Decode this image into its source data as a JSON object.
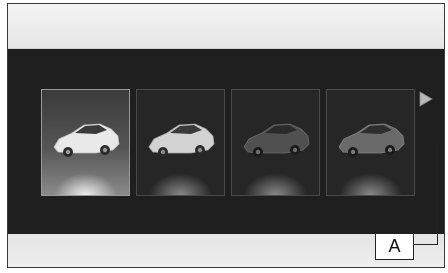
{
  "screen": {
    "color_options": [
      {
        "name": "color-option-1",
        "selected": true,
        "body_color": "#e9e9e9"
      },
      {
        "name": "color-option-2",
        "selected": false,
        "body_color": "#d2d2d2"
      },
      {
        "name": "color-option-3",
        "selected": false,
        "body_color": "#505050"
      },
      {
        "name": "color-option-4",
        "selected": false,
        "body_color": "#6a6a6a"
      }
    ],
    "next_arrow": "chevron-right-icon"
  },
  "callout": {
    "label": "A"
  }
}
